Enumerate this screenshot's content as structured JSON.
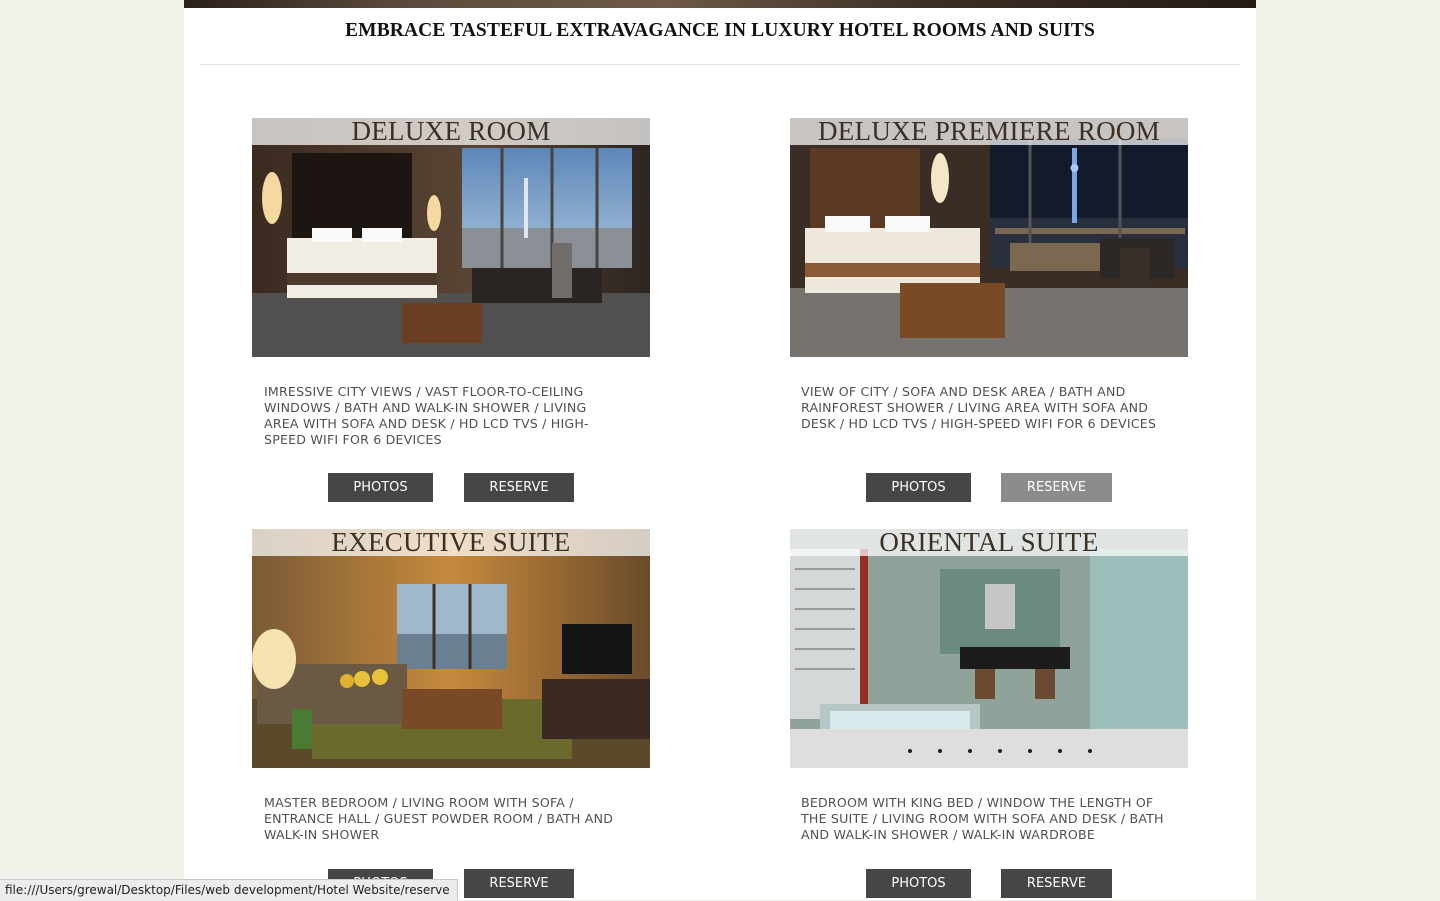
{
  "page": {
    "headline": "EMBRACE TASTEFUL EXTRAVAGANCE IN LUXURY HOTEL ROOMS AND SUITS"
  },
  "rooms": [
    {
      "title": "DELUXE ROOM",
      "description": "IMRESSIVE CITY VIEWS / VAST FLOOR-TO-CEILING WINDOWS / BATH AND WALK-IN SHOWER / LIVING AREA WITH SOFA AND DESK / HD LCD TVS / HIGH-SPEED WIFI FOR 6 DEVICES",
      "photos_label": "PHOTOS",
      "reserve_label": "RESERVE",
      "image_alt": "deluxe-room-photo"
    },
    {
      "title": "DELUXE PREMIERE ROOM",
      "description": "VIEW OF CITY / SOFA AND DESK AREA / BATH AND RAINFOREST SHOWER / LIVING AREA WITH SOFA AND DESK / HD LCD TVS / HIGH-SPEED WIFI FOR 6 DEVICES",
      "photos_label": "PHOTOS",
      "reserve_label": "RESERVE",
      "image_alt": "deluxe-premiere-room-photo"
    },
    {
      "title": "EXECUTIVE SUITE",
      "description": "MASTER BEDROOM / LIVING ROOM WITH SOFA / ENTRANCE HALL / GUEST POWDER ROOM / BATH AND WALK-IN SHOWER",
      "photos_label": "PHOTOS",
      "reserve_label": "RESERVE",
      "image_alt": "executive-suite-photo"
    },
    {
      "title": "ORIENTAL SUITE",
      "description": "BEDROOM WITH KING BED / WINDOW THE LENGTH OF THE SUITE / LIVING ROOM WITH SOFA AND DESK / BATH AND WALK-IN SHOWER / WALK-IN WARDROBE",
      "photos_label": "PHOTOS",
      "reserve_label": "RESERVE",
      "image_alt": "oriental-suite-photo"
    }
  ],
  "status_bar": {
    "url": "file:///Users/grewal/Desktop/Files/web development/Hotel Website/reserve"
  },
  "colors": {
    "page_background": "#f3f2ea",
    "button": "#464646",
    "button_hover": "#8c8c8c",
    "title_text": "#3c3026"
  }
}
